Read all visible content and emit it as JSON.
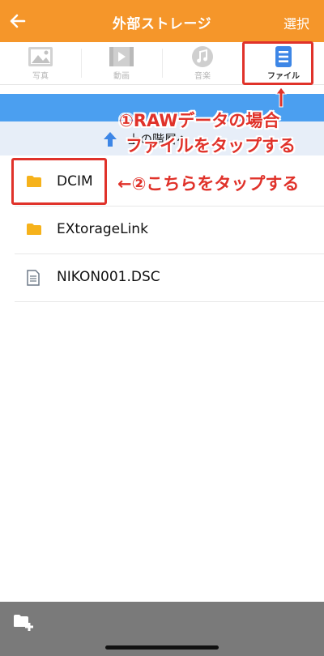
{
  "header": {
    "title": "外部ストレージ",
    "select_label": "選択"
  },
  "tabs": [
    {
      "label": "写真",
      "icon": "photo-icon",
      "active": false
    },
    {
      "label": "動画",
      "icon": "video-icon",
      "active": false
    },
    {
      "label": "音楽",
      "icon": "music-icon",
      "active": false
    },
    {
      "label": "ファイル",
      "icon": "file-list-icon",
      "active": true
    }
  ],
  "navigation": {
    "up_label": "上の階層へ"
  },
  "files": [
    {
      "name": "DCIM",
      "icon": "folder-icon"
    },
    {
      "name": "EXtorageLink",
      "icon": "folder-icon"
    },
    {
      "name": "NIKON001.DSC",
      "icon": "document-icon"
    }
  ],
  "annotations": {
    "step1_line1": "①RAWデータの場合",
    "step1_line2": "ファイルをタップする",
    "step2": "←②こちらをタップする"
  },
  "colors": {
    "header": "#f5962a",
    "accent_blue": "#4b9ff0",
    "annotation_red": "#e0322a",
    "folder": "#f6b21b"
  }
}
